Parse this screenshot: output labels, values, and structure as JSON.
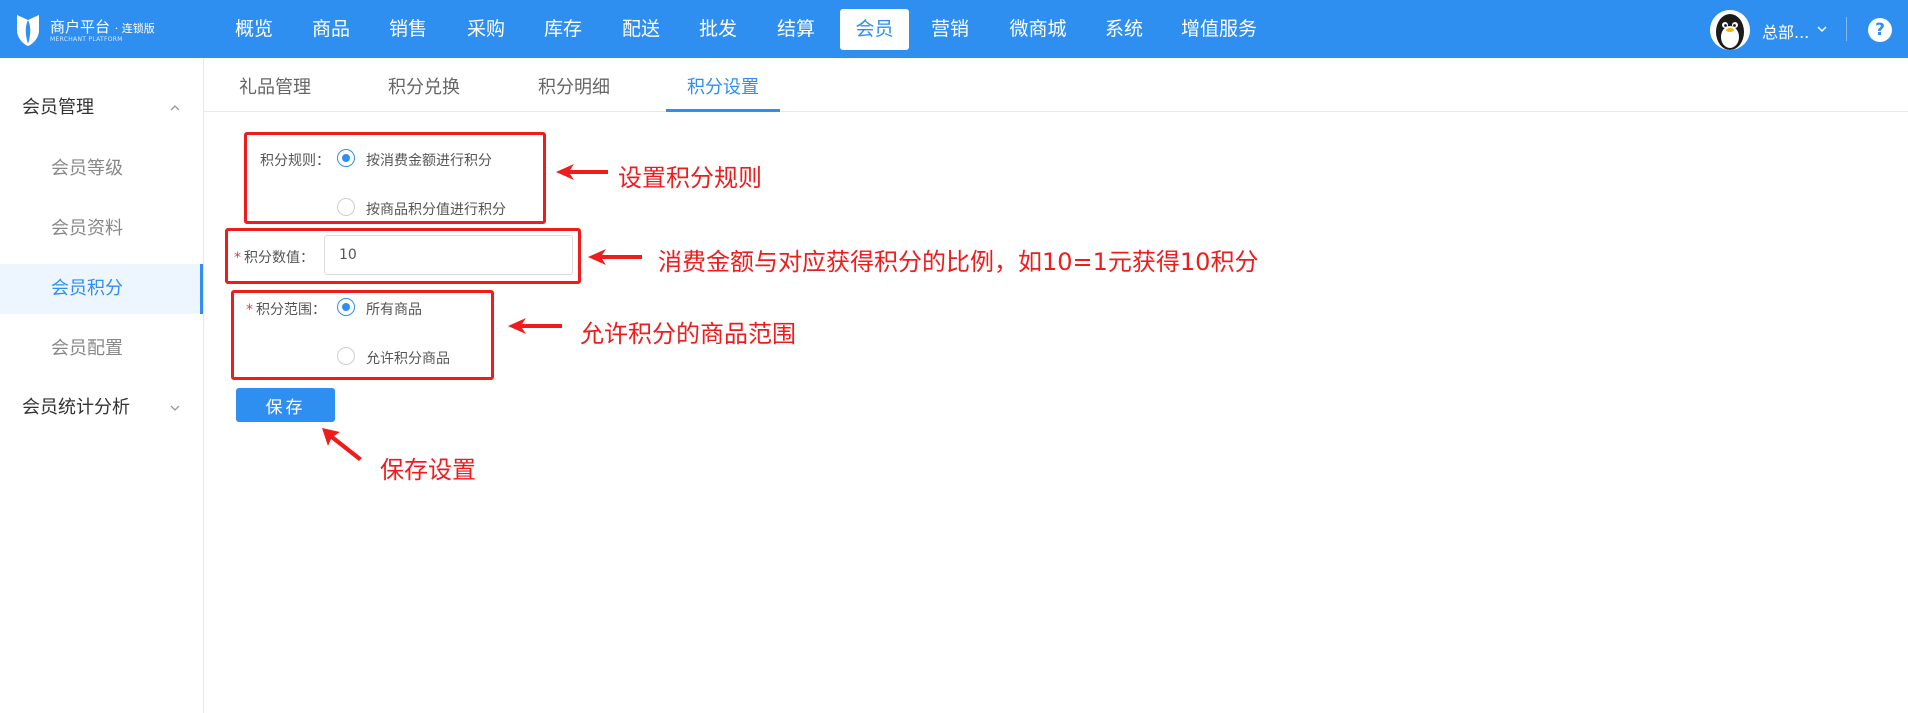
{
  "app": {
    "logo_title": "商户平台",
    "logo_edition": "· 连锁版",
    "logo_subtitle": "MERCHANT PLATFORM"
  },
  "topnav": [
    {
      "label": "概览"
    },
    {
      "label": "商品"
    },
    {
      "label": "销售"
    },
    {
      "label": "采购"
    },
    {
      "label": "库存"
    },
    {
      "label": "配送"
    },
    {
      "label": "批发"
    },
    {
      "label": "结算"
    },
    {
      "label": "会员",
      "active": true
    },
    {
      "label": "营销"
    },
    {
      "label": "微商城"
    },
    {
      "label": "系统"
    },
    {
      "label": "增值服务"
    }
  ],
  "user": {
    "name": "总部..."
  },
  "help": {
    "label": "?"
  },
  "sidebar": {
    "groups": [
      {
        "label": "会员管理",
        "expanded": true,
        "items": [
          {
            "label": "会员等级"
          },
          {
            "label": "会员资料"
          },
          {
            "label": "会员积分",
            "active": true
          },
          {
            "label": "会员配置"
          }
        ]
      },
      {
        "label": "会员统计分析",
        "expanded": false,
        "items": []
      }
    ]
  },
  "tabs": [
    {
      "label": "礼品管理"
    },
    {
      "label": "积分兑换"
    },
    {
      "label": "积分明细"
    },
    {
      "label": "积分设置",
      "active": true
    }
  ],
  "form": {
    "rule": {
      "label": "积分规则：",
      "options": [
        {
          "label": "按消费金额进行积分",
          "checked": true
        },
        {
          "label": "按商品积分值进行积分",
          "checked": false
        }
      ]
    },
    "value": {
      "required_mark": "*",
      "label": "积分数值：",
      "value": "10"
    },
    "scope": {
      "required_mark": "*",
      "label": "积分范围：",
      "options": [
        {
          "label": "所有商品",
          "checked": true
        },
        {
          "label": "允许积分商品",
          "checked": false
        }
      ]
    },
    "save_label": "保存"
  },
  "annotations": [
    {
      "text": "设置积分规则"
    },
    {
      "text": "消费金额与对应获得积分的比例，如10=1元获得10积分"
    },
    {
      "text": "允许积分的商品范围"
    },
    {
      "text": "保存设置"
    }
  ],
  "colors": {
    "brand": "#2f8ff0",
    "annotation": "#ef1c1c",
    "sidebar_active_bg": "#edf5ff"
  }
}
